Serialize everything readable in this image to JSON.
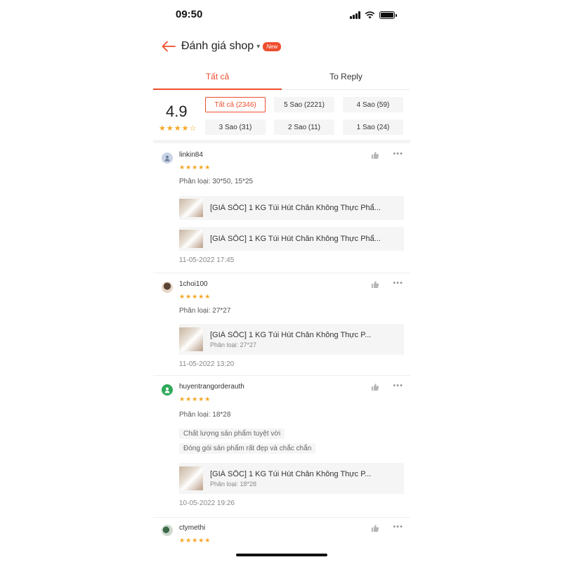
{
  "status": {
    "time": "09:50"
  },
  "header": {
    "title": "Đánh giá shop",
    "caret": "▾",
    "badge": "New"
  },
  "tabs": [
    {
      "label": "Tất cả"
    },
    {
      "label": "To Reply"
    }
  ],
  "summary": {
    "score": "4.9",
    "stars": "★★★★☆",
    "filters": [
      "Tất cả (2346)",
      "5 Sao (2221)",
      "4 Sao (59)",
      "3 Sao (31)",
      "2 Sao (11)",
      "1 Sao (24)"
    ]
  },
  "reviews": [
    {
      "user": "linkin84",
      "stars": "★★★★★",
      "variant": "Phân loại: 30*50, 15*25",
      "products": [
        {
          "name": "[GIÁ SỐC] 1 KG Túi Hút Chân Không Thực Phẩ..."
        },
        {
          "name": "[GIÁ SỐC] 1 KG Túi Hút Chân Không Thực Phẩ..."
        }
      ],
      "time": "11-05-2022 17:45"
    },
    {
      "user": "1choi100",
      "stars": "★★★★★",
      "variant": "Phân loại: 27*27",
      "products": [
        {
          "name": "[GIÁ SỐC] 1 KG Túi Hút Chân Không Thực P...",
          "variant": "Phân loại: 27*27"
        }
      ],
      "time": "11-05-2022 13:20"
    },
    {
      "user": "huyentrangorderauth",
      "stars": "★★★★★",
      "variant": "Phân loại: 18*28",
      "tags": [
        "Chất lượng sản phẩm tuyệt vời",
        "Đóng gói sản phẩm rất đẹp và chắc chắn"
      ],
      "products": [
        {
          "name": "[GIÁ SỐC] 1 KG Túi Hút Chân Không Thực P...",
          "variant": "Phân loại: 18*28"
        }
      ],
      "time": "10-05-2022 19:26"
    },
    {
      "user": "ctymethi",
      "stars": "★★★★★"
    }
  ],
  "more_glyph": "•••",
  "colors": {
    "accent": "#ee4d2d",
    "star": "#f5a623",
    "chip_bg": "#f5f5f5"
  }
}
